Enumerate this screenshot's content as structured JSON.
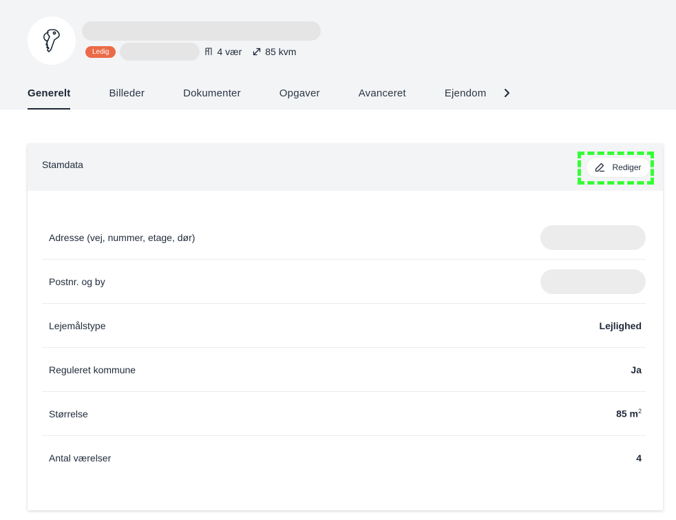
{
  "header": {
    "status_badge": "Ledig",
    "rooms": "4 vær",
    "size": "85 kvm"
  },
  "tabs": [
    {
      "label": "Generelt",
      "active": true
    },
    {
      "label": "Billeder"
    },
    {
      "label": "Dokumenter"
    },
    {
      "label": "Opgaver"
    },
    {
      "label": "Avanceret"
    },
    {
      "label": "Ejendom"
    }
  ],
  "card": {
    "title": "Stamdata",
    "edit_label": "Rediger",
    "rows": [
      {
        "label": "Adresse (vej, nummer, etage, dør)",
        "value": ""
      },
      {
        "label": "Postnr. og by",
        "value": ""
      },
      {
        "label": "Lejemålstype",
        "value": "Lejlighed"
      },
      {
        "label": "Reguleret kommune",
        "value": "Ja"
      },
      {
        "label": "Størrelse",
        "value": "85 m",
        "sup": "2"
      },
      {
        "label": "Antal værelser",
        "value": "4"
      }
    ]
  },
  "colors": {
    "badge": "#ec6a47",
    "highlight": "#33ff33",
    "header_bg": "#f3f4f6"
  },
  "icons": {
    "avatar": "keys-icon",
    "rooms": "door-icon",
    "size": "resize-arrow-icon",
    "edit": "pencil-icon",
    "tabs_more": "chevron-right-icon"
  }
}
